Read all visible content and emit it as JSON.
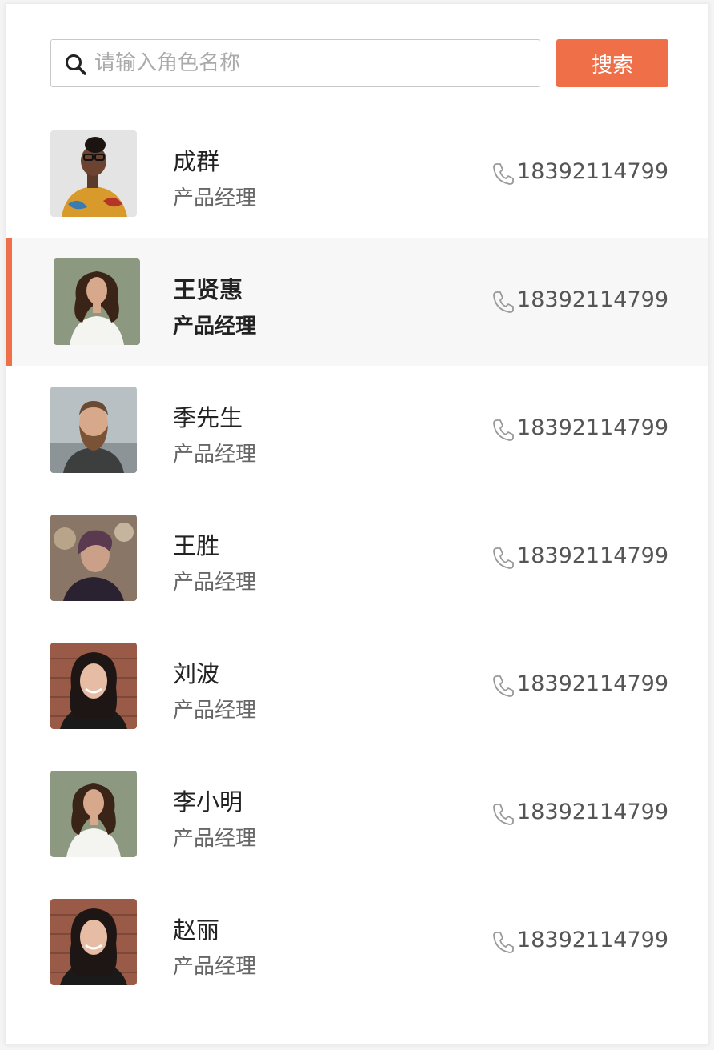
{
  "search": {
    "placeholder": "请输入角色名称",
    "button_label": "搜索"
  },
  "colors": {
    "accent": "#ee6f48",
    "selected_bg": "#f7f7f7"
  },
  "contacts": [
    {
      "name": "成群",
      "role": "产品经理",
      "phone": "18392114799",
      "selected": false
    },
    {
      "name": "王贤惠",
      "role": "产品经理",
      "phone": "18392114799",
      "selected": true
    },
    {
      "name": "季先生",
      "role": "产品经理",
      "phone": "18392114799",
      "selected": false
    },
    {
      "name": "王胜",
      "role": "产品经理",
      "phone": "18392114799",
      "selected": false
    },
    {
      "name": "刘波",
      "role": "产品经理",
      "phone": "18392114799",
      "selected": false
    },
    {
      "name": "李小明",
      "role": "产品经理",
      "phone": "18392114799",
      "selected": false
    },
    {
      "name": "赵丽",
      "role": "产品经理",
      "phone": "18392114799",
      "selected": false
    }
  ],
  "icons": {
    "search": "search-icon",
    "phone": "phone-icon"
  }
}
